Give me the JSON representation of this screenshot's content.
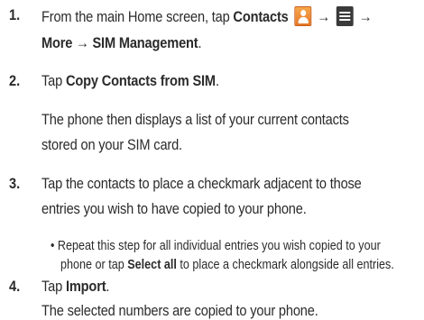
{
  "steps": [
    {
      "number": "1.",
      "line1_pre": "From the main Home screen, tap ",
      "line1_bold": "Contacts",
      "arrow1": "→",
      "arrow2": "→",
      "line2": "More → SIM Management",
      "line2_end": "."
    },
    {
      "number": "2.",
      "pre": "Tap ",
      "bold": "Copy Contacts from SIM",
      "end": ".",
      "para1": "The phone then displays a list of your current contacts",
      "para2": "stored on your SIM card."
    },
    {
      "number": "3.",
      "line1": "Tap the contacts to place a checkmark adjacent to those",
      "line2": "entries you wish to have copied to your phone.",
      "bullet": "•",
      "bullet_line1": "Repeat this step for all individual entries you wish copied to your",
      "bullet_line2_pre": "phone or tap ",
      "bullet_line2_bold": "Select all",
      "bullet_line2_post": " to place a checkmark alongside all entries."
    },
    {
      "number": "4.",
      "pre": "Tap ",
      "bold": "Import",
      "end": ".",
      "para1": "The selected numbers are copied to your phone."
    }
  ],
  "icons": {
    "contacts": "contacts-icon",
    "menu": "menu-icon"
  }
}
